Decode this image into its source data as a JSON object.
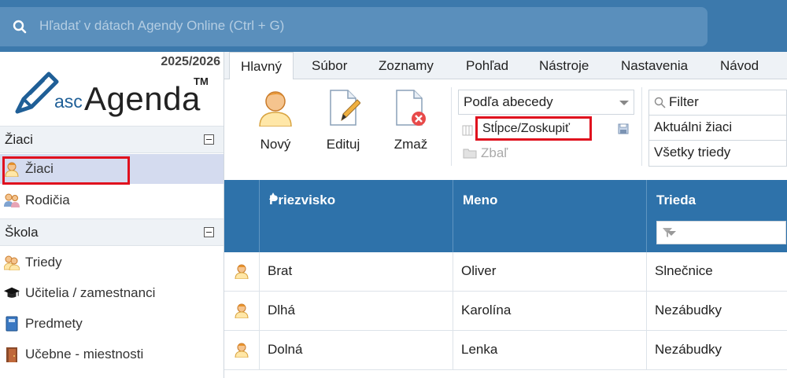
{
  "search": {
    "placeholder": "Hľadať v dátach Agendy Online (Ctrl + G)"
  },
  "left": {
    "year": "2025/2026",
    "logo": {
      "prefix": "asc",
      "name": "Agenda",
      "tm": "TM"
    },
    "sections": [
      {
        "label": "Žiaci",
        "items": [
          {
            "label": "Žiaci",
            "icon": "student-icon"
          },
          {
            "label": "Rodičia",
            "icon": "parents-icon"
          }
        ]
      },
      {
        "label": "Škola",
        "items": [
          {
            "label": "Triedy",
            "icon": "classes-icon"
          },
          {
            "label": "Učitelia / zamestnanci",
            "icon": "graduation-cap-icon"
          },
          {
            "label": "Predmety",
            "icon": "book-icon"
          },
          {
            "label": "Učebne - miestnosti",
            "icon": "door-icon"
          }
        ]
      }
    ]
  },
  "tabs": [
    "Hlavný",
    "Súbor",
    "Zoznamy",
    "Pohľad",
    "Nástroje",
    "Nastavenia",
    "Návod"
  ],
  "ribbon": {
    "new_label": "Nový",
    "edit_label": "Edituj",
    "delete_label": "Zmaž",
    "sort_value": "Podľa abecedy",
    "columns_label": "Stĺpce/Zoskupiť",
    "collapse_label": "Zbaľ",
    "filter_placeholder": "Filter",
    "filter_options": [
      "Aktuálni žiaci",
      "Všetky triedy"
    ]
  },
  "grid": {
    "columns": [
      "Priezvisko",
      "Meno",
      "Trieda"
    ],
    "rows": [
      {
        "surname": "Brat",
        "name": "Oliver",
        "class": "Slnečnice"
      },
      {
        "surname": "Dlhá",
        "name": "Karolína",
        "class": "Nezábudky"
      },
      {
        "surname": "Dolná",
        "name": "Lenka",
        "class": "Nezábudky"
      }
    ]
  },
  "colors": {
    "topbar": "#3c79ac",
    "grid_header": "#2e72aa",
    "highlight": "#e0101e",
    "active_nav": "#d4dbef"
  }
}
